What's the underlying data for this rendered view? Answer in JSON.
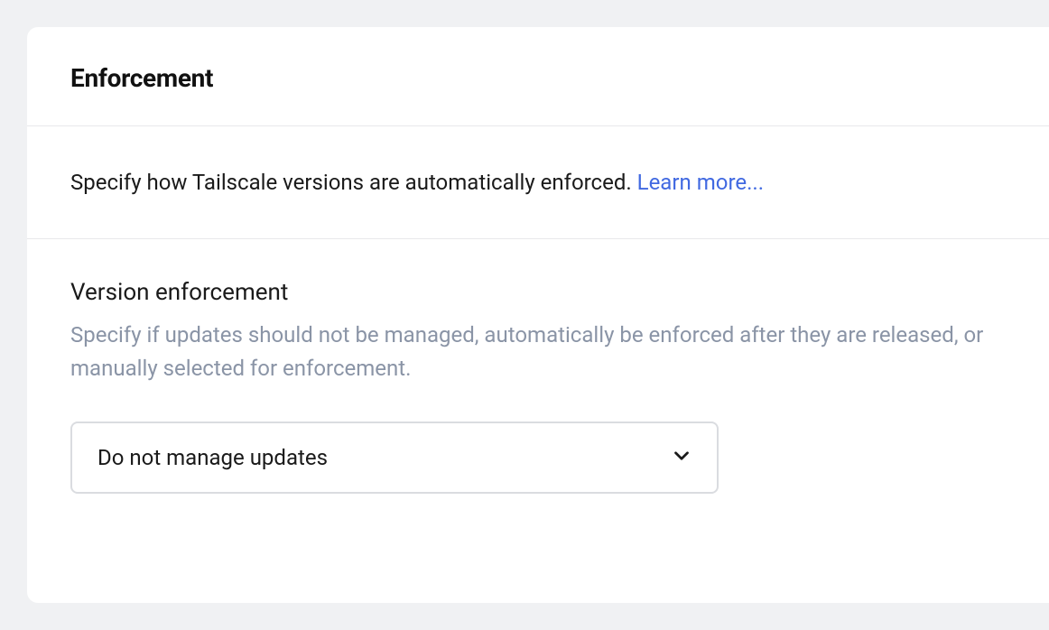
{
  "header": {
    "title": "Enforcement"
  },
  "intro": {
    "text": "Specify how Tailscale versions are automatically enforced. ",
    "learn_more": "Learn more..."
  },
  "version_enforcement": {
    "title": "Version enforcement",
    "description": "Specify if updates should not be managed, automatically be enforced after they are released, or manually selected for enforcement.",
    "selected_option": "Do not manage updates"
  }
}
